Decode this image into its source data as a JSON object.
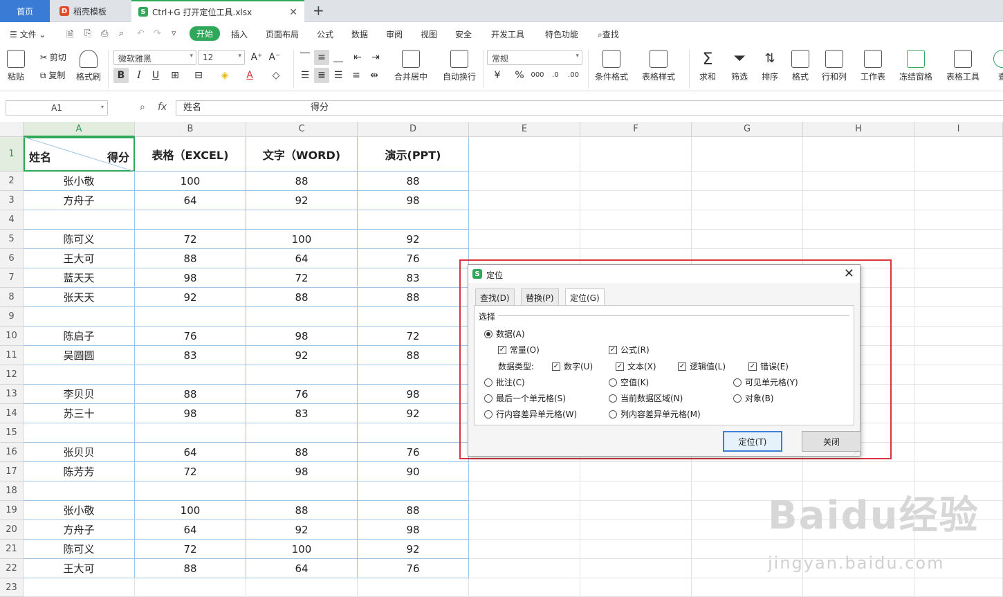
{
  "tabs": {
    "home": "首页",
    "template": "稻壳模板",
    "file": "Ctrl+G 打开定位工具.xlsx",
    "add": "+"
  },
  "menu": {
    "file": "文件",
    "start": "开始",
    "insert": "插入",
    "page_layout": "页面布局",
    "formula": "公式",
    "data": "数据",
    "review": "审阅",
    "view": "视图",
    "security": "安全",
    "dev": "开发工具",
    "special": "特色功能",
    "search": "查找"
  },
  "ribbon": {
    "paste": "粘贴",
    "cut": "剪切",
    "copy": "复制",
    "format_painter": "格式刷",
    "font_name": "微软雅黑",
    "font_size": "12",
    "merge": "合并居中",
    "wrap": "自动换行",
    "number_format": "常规",
    "cond_format": "条件格式",
    "table_style": "表格样式",
    "sum": "求和",
    "filter": "筛选",
    "sort": "排序",
    "format": "格式",
    "rows_cols": "行和列",
    "worksheet": "工作表",
    "freeze": "冻结窗格",
    "table_tools": "表格工具",
    "more": "查"
  },
  "formula_bar": {
    "name_box": "A1",
    "fx": "fx",
    "content_left": "姓名",
    "content_right": "得分"
  },
  "columns": [
    "A",
    "B",
    "C",
    "D",
    "E",
    "F",
    "G",
    "H",
    "I"
  ],
  "rows": [
    "1",
    "2",
    "3",
    "4",
    "5",
    "6",
    "7",
    "8",
    "9",
    "10",
    "11",
    "12",
    "13",
    "14",
    "15",
    "16",
    "17",
    "18",
    "19",
    "20",
    "21",
    "22",
    "23"
  ],
  "header_row": {
    "a1_left": "姓名",
    "a1_right": "得分",
    "b": "表格（EXCEL)",
    "c": "文字（WORD)",
    "d": "演示(PPT)"
  },
  "data_rows": [
    [
      "张小敬",
      "100",
      "88",
      "88"
    ],
    [
      "方舟子",
      "64",
      "92",
      "98"
    ],
    [
      "",
      "",
      "",
      ""
    ],
    [
      "陈可义",
      "72",
      "100",
      "92"
    ],
    [
      "王大可",
      "88",
      "64",
      "76"
    ],
    [
      "蓝天天",
      "98",
      "72",
      "83"
    ],
    [
      "张天天",
      "92",
      "88",
      "88"
    ],
    [
      "",
      "",
      "",
      ""
    ],
    [
      "陈启子",
      "76",
      "98",
      "72"
    ],
    [
      "吴圆圆",
      "83",
      "92",
      "88"
    ],
    [
      "",
      "",
      "",
      ""
    ],
    [
      "李贝贝",
      "88",
      "76",
      "98"
    ],
    [
      "苏三十",
      "98",
      "83",
      "92"
    ],
    [
      "",
      "",
      "",
      ""
    ],
    [
      "张贝贝",
      "64",
      "88",
      "76"
    ],
    [
      "陈芳芳",
      "72",
      "98",
      "90"
    ],
    [
      "",
      "",
      "",
      ""
    ],
    [
      "张小敬",
      "100",
      "88",
      "88"
    ],
    [
      "方舟子",
      "64",
      "92",
      "98"
    ],
    [
      "陈可义",
      "72",
      "100",
      "92"
    ],
    [
      "王大可",
      "88",
      "64",
      "76"
    ]
  ],
  "dialog": {
    "title": "定位",
    "tabs": [
      "查找(D)",
      "替换(P)",
      "定位(G)"
    ],
    "group": "选择",
    "data_opt": "数据(A)",
    "constant": "常量(O)",
    "formula": "公式(R)",
    "data_type_label": "数据类型:",
    "number": "数字(U)",
    "text": "文本(X)",
    "logical": "逻辑值(L)",
    "error": "错误(E)",
    "comment": "批注(C)",
    "blank": "空值(K)",
    "visible": "可见单元格(Y)",
    "last_cell": "最后一个单元格(S)",
    "current_region": "当前数据区域(N)",
    "object": "对象(B)",
    "row_diff": "行内容差异单元格(W)",
    "col_diff": "列内容差异单元格(M)",
    "locate_btn": "定位(T)",
    "close_btn": "关闭"
  },
  "watermark": {
    "brand": "Baidu经验",
    "url": "jingyan.baidu.com"
  },
  "colors": {
    "accent_green": "#2fa85a",
    "home_tab_blue": "#3a7bd5",
    "highlight_red": "#d9343a",
    "table_border_blue": "#9ec5e8"
  }
}
